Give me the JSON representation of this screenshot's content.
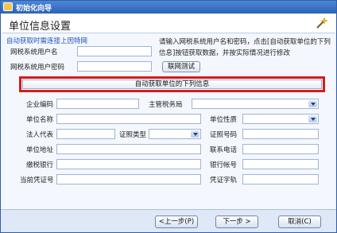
{
  "window": {
    "title": "初始化向导"
  },
  "header": {
    "page_title": "单位信息设置"
  },
  "hint": "自动获取时需连接上因特网",
  "instruction": "请输入网税系统用户名和密码，点击[自动获取单位的下列信息]按钮获取数据，并按实际情况进行修改",
  "login": {
    "username_label": "网税系统用户名",
    "username_value": "",
    "password_label": "网税系统用户密码",
    "password_value": "",
    "test_button": "联网测试"
  },
  "auto_fetch_button": "自动获取单位的下列信息",
  "form": {
    "enterprise_code_label": "企业编码",
    "tax_authority_label": "主管税务局",
    "unit_name_label": "单位名称",
    "unit_nature_label": "单位性质",
    "legal_rep_label": "法人代表",
    "id_type_label": "证照类型",
    "id_number_label": "证照号码",
    "address_label": "单位地址",
    "phone_label": "联系电话",
    "bank_label": "缴税银行",
    "account_label": "银行帐号",
    "voucher_label": "当前凭证号",
    "voucher_word_label": "凭证字轨"
  },
  "footer": {
    "prev_button": "<上一步(P)",
    "next_button": "下一步 >",
    "cancel_button": "取消(C)"
  },
  "colors": {
    "highlight": "#d51b1b",
    "hint": "#1f4fc2",
    "titlebar": "#2c62b8"
  }
}
